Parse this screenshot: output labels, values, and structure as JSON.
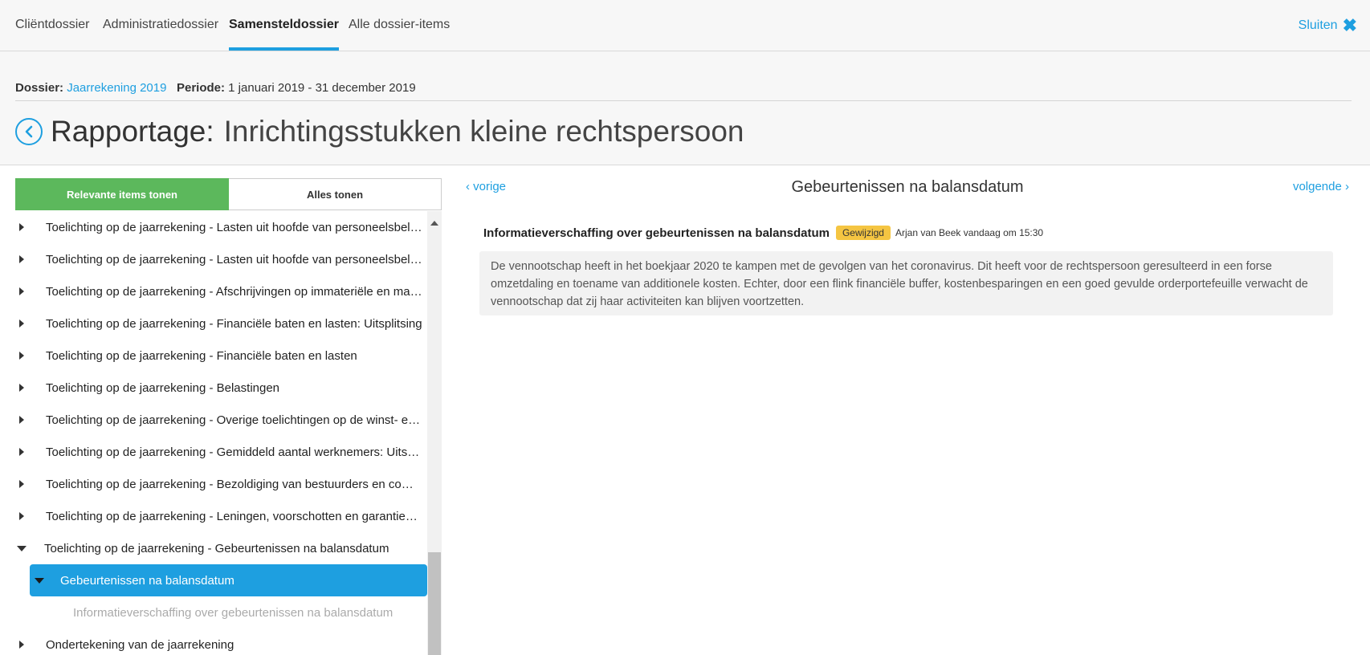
{
  "tabs": [
    {
      "label": "Cliëntdossier",
      "active": false
    },
    {
      "label": "Administratiedossier",
      "active": false
    },
    {
      "label": "Samensteldossier",
      "active": true
    },
    {
      "label": "Alle dossier-items",
      "active": false
    }
  ],
  "close_label": "Sluiten",
  "header": {
    "dossier_label": "Dossier:",
    "dossier_value": "Jaarrekening 2019",
    "periode_label": "Periode:",
    "periode_value": "1 januari 2019 - 31 december 2019",
    "title_prefix": "Rapportage:",
    "title": "Inrichtingsstukken kleine rechtspersoon"
  },
  "filter": {
    "relevant_label": "Relevante items tonen",
    "all_label": "Alles tonen"
  },
  "tree": {
    "items": [
      "Toelichting op de jaarrekening - Lasten uit hoofde van personeelsbeloningen: Uitsplitsing",
      "Toelichting op de jaarrekening - Lasten uit hoofde van personeelsbeloningen",
      "Toelichting op de jaarrekening - Afschrijvingen op immateriële en materiële vaste activa",
      "Toelichting op de jaarrekening - Financiële baten en lasten: Uitsplitsing",
      "Toelichting op de jaarrekening - Financiële baten en lasten",
      "Toelichting op de jaarrekening - Belastingen",
      "Toelichting op de jaarrekening - Overige toelichtingen op de winst- en verliesrekening",
      "Toelichting op de jaarrekening - Gemiddeld aantal werknemers: Uitsplitsing",
      "Toelichting op de jaarrekening - Bezoldiging van bestuurders en commissarissen",
      "Toelichting op de jaarrekening - Leningen, voorschotten en garanties: Toelichting"
    ],
    "expanded_item": "Toelichting op de jaarrekening - Gebeurtenissen na balansdatum",
    "selected_item": "Gebeurtenissen na balansdatum",
    "sub_item": "Informatieverschaffing over gebeurtenissen na balansdatum",
    "last_item": "Ondertekening van de jaarrekening"
  },
  "content": {
    "prev_label": "vorige",
    "next_label": "volgende",
    "section_title": "Gebeurtenissen na balansdatum",
    "item_title": "Informatieverschaffing over gebeurtenissen na balansdatum",
    "badge": "Gewijzigd",
    "author": "Arjan van Beek vandaag om 15:30",
    "body": "De vennootschap heeft in het boekjaar 2020 te kampen met de gevolgen van het coronavirus. Dit heeft voor de rechtspersoon geresulteerd in een forse omzetdaling en toename van additionele kosten. Echter, door een flink financiële buffer, kostenbesparingen en een goed gevulde orderportefeuille verwacht de vennootschap dat zij haar activiteiten kan blijven voortzetten."
  }
}
